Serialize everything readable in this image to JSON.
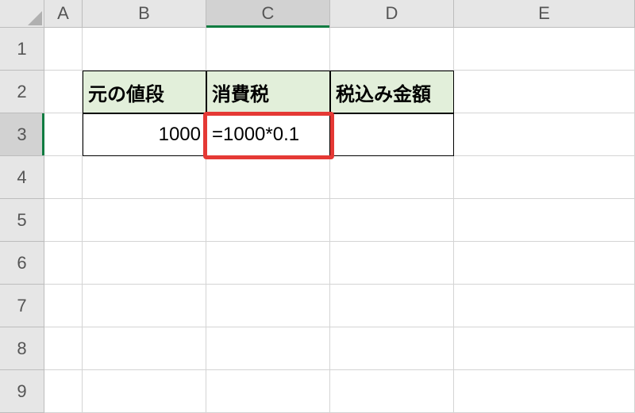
{
  "columns": [
    "A",
    "B",
    "C",
    "D",
    "E"
  ],
  "rows": [
    "1",
    "2",
    "3",
    "4",
    "5",
    "6",
    "7",
    "8",
    "9"
  ],
  "selected_column": "C",
  "selected_row": "3",
  "table": {
    "headers": {
      "B2": "元の値段",
      "C2": "消費税",
      "D2": "税込み金額"
    },
    "cells": {
      "B3": "1000",
      "C3": "=1000*0.1",
      "D3": ""
    }
  },
  "highlight_cell": "C3"
}
